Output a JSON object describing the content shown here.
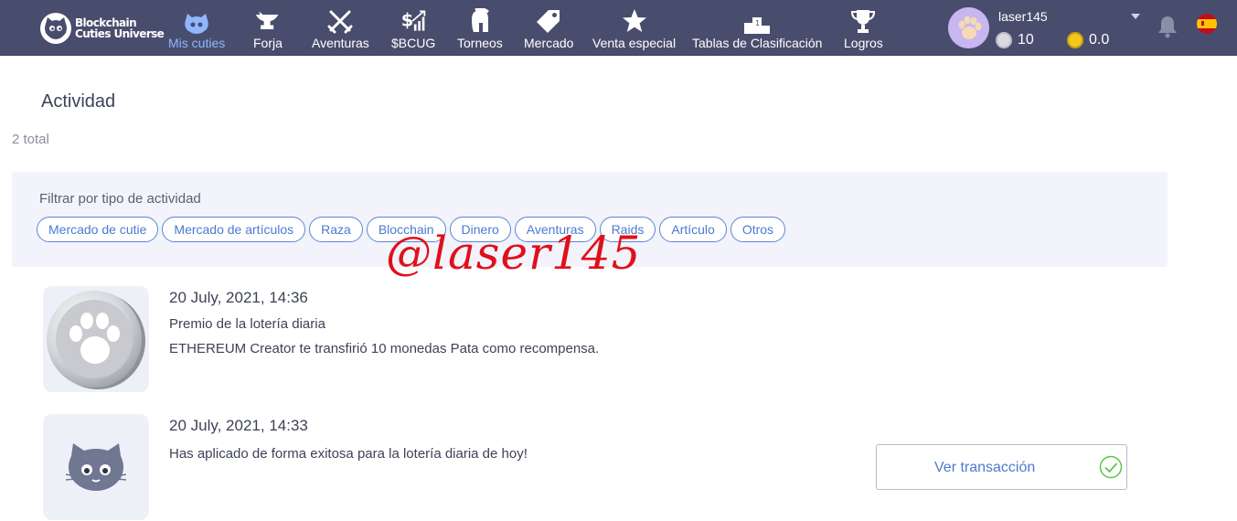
{
  "brand": {
    "line1": "Blockchain",
    "line2": "Cuties Universe"
  },
  "nav": {
    "items": [
      {
        "label": "Mis cuties",
        "icon": "cat-face-icon",
        "active": true
      },
      {
        "label": "Forja",
        "icon": "anvil-icon"
      },
      {
        "label": "Aventuras",
        "icon": "crossed-swords-icon"
      },
      {
        "label": "$BCUG",
        "icon": "dollar-chart-icon"
      },
      {
        "label": "Torneos",
        "icon": "spartan-helmet-icon"
      },
      {
        "label": "Mercado",
        "icon": "price-tag-icon"
      },
      {
        "label": "Venta especial",
        "icon": "star-icon"
      },
      {
        "label": "Tablas de Clasificación",
        "icon": "podium-icon"
      },
      {
        "label": "Logros",
        "icon": "trophy-icon"
      }
    ]
  },
  "user": {
    "name": "laser145",
    "paw_coins": "10",
    "eth_balance": "0.0",
    "language": "es"
  },
  "page": {
    "title": "Actividad",
    "total": "2 total"
  },
  "filter": {
    "label": "Filtrar por tipo de actividad",
    "chips": [
      "Mercado de cutie",
      "Mercado de artículos",
      "Raza",
      "Blocchain",
      "Dinero",
      "Aventuras",
      "Raids",
      "Artículo",
      "Otros"
    ]
  },
  "watermark": "@laser145",
  "activities": [
    {
      "time": "20 July, 2021, 14:36",
      "title": "Premio de la lotería diaria",
      "detail": "ETHEREUM Creator te transfirió 10 monedas Pata como recompensa.",
      "icon": "paw-coin-icon"
    },
    {
      "time": "20 July, 2021, 14:33",
      "title": "Has aplicado de forma exitosa para la lotería diaria de hoy!",
      "icon": "cat-face-icon",
      "action": "Ver transacción"
    }
  ],
  "colors": {
    "nav_bg": "#494d6d",
    "active_nav": "#8fb7ff",
    "chip_border": "#5b86d6",
    "link": "#4a7bd0",
    "success": "#5cc44c",
    "watermark": "#e0101a"
  }
}
